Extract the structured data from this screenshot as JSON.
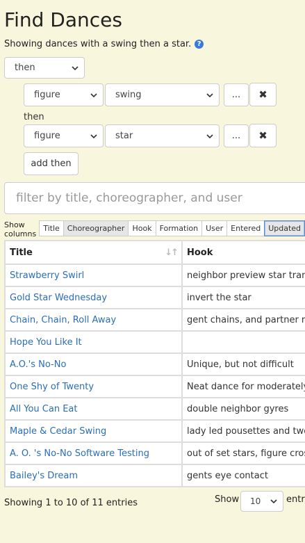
{
  "page": {
    "title": "Find Dances",
    "subtitle": "Showing dances with a swing then a star.",
    "help_glyph": "?"
  },
  "query": {
    "top_operator": "then",
    "rows": [
      {
        "type": "figure",
        "value": "swing",
        "more": "...",
        "remove": "✖"
      },
      {
        "type": "figure",
        "value": "star",
        "more": "...",
        "remove": "✖"
      }
    ],
    "between_label": "then",
    "add_button": "add then"
  },
  "filter": {
    "placeholder": "filter by title, choreographer, and user"
  },
  "columns": {
    "label": "Show columns",
    "toggles": [
      "Title",
      "Choreographer",
      "Hook",
      "Formation",
      "User",
      "Entered",
      "Updated"
    ]
  },
  "table": {
    "headers": [
      "Title",
      "Hook"
    ],
    "sort_glyph": "↓↑",
    "rows": [
      {
        "title": "Strawberry Swirl",
        "hook": "neighbor preview star transit"
      },
      {
        "title": "Gold Star Wednesday",
        "hook": "invert the star"
      },
      {
        "title": "Chain, Chain, Roll Away",
        "hook": "gent chains, and partner roll"
      },
      {
        "title": "Hope You Like It",
        "hook": ""
      },
      {
        "title": "A.O.'s No-No",
        "hook": "Unique, but not difficult"
      },
      {
        "title": "One Shy of Twenty",
        "hook": "Neat dance for moderately ex"
      },
      {
        "title": "All You Can Eat",
        "hook": "double neighbor gyres"
      },
      {
        "title": "Maple & Cedar Swing",
        "hook": "lady led pousettes and two lo"
      },
      {
        "title": "A. O. 's No-No Software Testing",
        "hook": "out of set stars, figure crossin"
      },
      {
        "title": "Bailey's Dream",
        "hook": "gents eye contact"
      }
    ]
  },
  "footer": {
    "info": "Showing 1 to 10 of 11 entries",
    "show_label": "Show",
    "page_size": "10",
    "entries_label": "entri"
  }
}
